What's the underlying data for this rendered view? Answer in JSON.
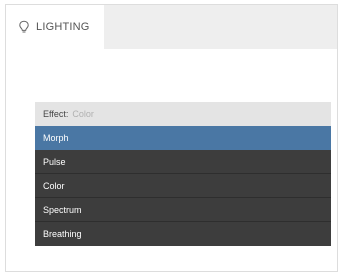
{
  "tab": {
    "icon": "lightbulb-icon",
    "label": "LIGHTING"
  },
  "effect": {
    "label": "Effect:",
    "value": "Color"
  },
  "dropdown": {
    "options": [
      {
        "label": "Morph",
        "selected": true
      },
      {
        "label": "Pulse",
        "selected": false
      },
      {
        "label": "Color",
        "selected": false
      },
      {
        "label": "Spectrum",
        "selected": false
      },
      {
        "label": "Breathing",
        "selected": false
      }
    ]
  },
  "colors": {
    "selected": "#4a77a4",
    "option_bg": "#3d3d3d",
    "tabbar_bg": "#eeeeee"
  }
}
